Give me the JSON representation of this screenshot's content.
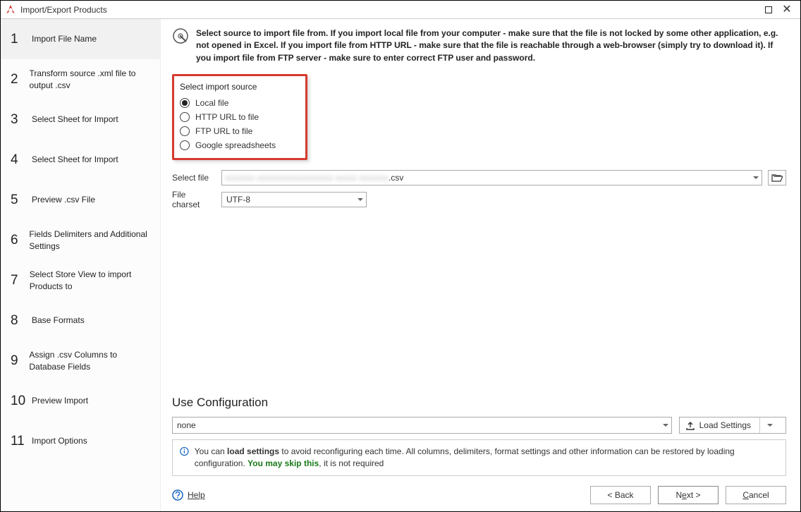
{
  "window": {
    "title": "Import/Export Products"
  },
  "sidebar": {
    "steps": [
      {
        "num": "1",
        "label": "Import File Name"
      },
      {
        "num": "2",
        "label": "Transform source .xml file to output .csv"
      },
      {
        "num": "3",
        "label": "Select Sheet for Import"
      },
      {
        "num": "4",
        "label": "Select Sheet for Import"
      },
      {
        "num": "5",
        "label": "Preview .csv File"
      },
      {
        "num": "6",
        "label": "Fields Delimiters and Additional Settings"
      },
      {
        "num": "7",
        "label": "Select Store View to import Products to"
      },
      {
        "num": "8",
        "label": "Base Formats"
      },
      {
        "num": "9",
        "label": "Assign .csv Columns to Database Fields"
      },
      {
        "num": "10",
        "label": "Preview Import"
      },
      {
        "num": "11",
        "label": "Import Options"
      }
    ],
    "active_index": 0
  },
  "main": {
    "info_text": "Select source to import file from. If you import local file from your computer - make sure that the file is not locked by some other application, e.g. not opened in Excel. If you import file from HTTP URL - make sure that the file is reachable through a web-browser (simply try to download it). If you import file from FTP server - make sure to enter correct FTP user and password.",
    "source_group": {
      "label": "Select import source",
      "options": [
        {
          "label": "Local file"
        },
        {
          "label": "HTTP URL to file"
        },
        {
          "label": "FTP URL to file"
        },
        {
          "label": "Google spreadsheets"
        }
      ],
      "selected_index": 0
    },
    "select_file": {
      "label": "Select file",
      "suffix": ".csv"
    },
    "file_charset": {
      "label": "File charset",
      "value": "UTF-8"
    },
    "configuration": {
      "title": "Use Configuration",
      "value": "none",
      "load_button": "Load Settings"
    },
    "hint": {
      "p1": "You can ",
      "b1": "load settings",
      "p2": " to avoid reconfiguring each time. All columns, delimiters, format settings and other information can be restored by loading configuration. ",
      "g1": "You may skip this",
      "p3": ", it is not required"
    }
  },
  "footer": {
    "help": "Help",
    "back": "< Back",
    "next_pre": "N",
    "next_u": "e",
    "next_post": "xt >",
    "cancel_pre": "",
    "cancel_u": "C",
    "cancel_post": "ancel"
  }
}
